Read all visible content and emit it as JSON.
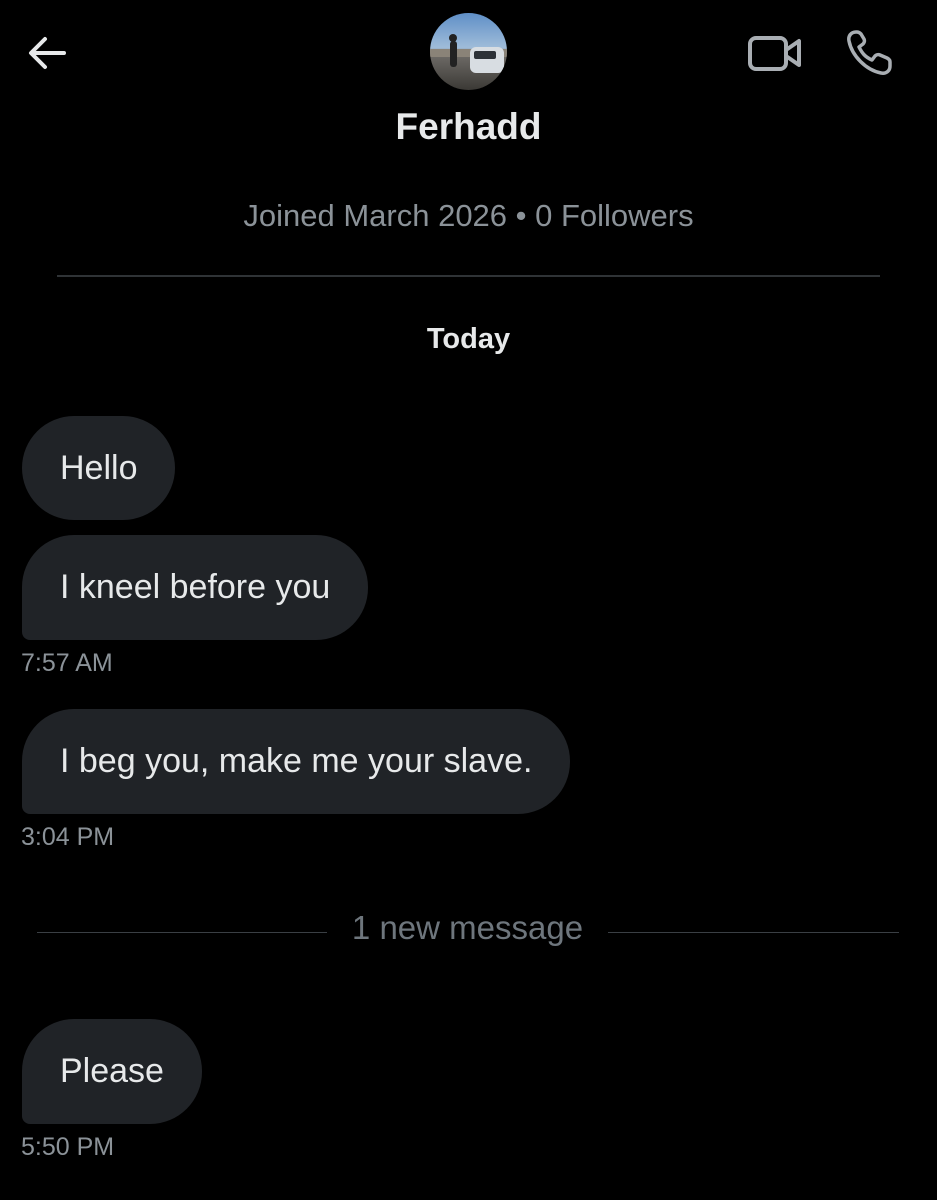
{
  "header": {
    "back_icon": "arrow-left-icon",
    "video_icon": "video-camera-icon",
    "call_icon": "phone-icon",
    "avatar_icon": "avatar-photo"
  },
  "profile": {
    "name": "Ferhadd",
    "meta": "Joined March 2026 • 0 Followers"
  },
  "conversation": {
    "day_label": "Today",
    "messages": [
      {
        "text": "Hello",
        "time": ""
      },
      {
        "text": "I kneel before you",
        "time": "7:57 AM"
      },
      {
        "text": "I beg you, make me your slave.",
        "time": "3:04 PM"
      },
      {
        "text": "Please",
        "time": "5:50 PM"
      }
    ],
    "new_message_label": "1 new message"
  },
  "colors": {
    "background": "#000000",
    "bubble": "#202327",
    "text": "#e7e9ea",
    "muted": "#8b9298"
  }
}
